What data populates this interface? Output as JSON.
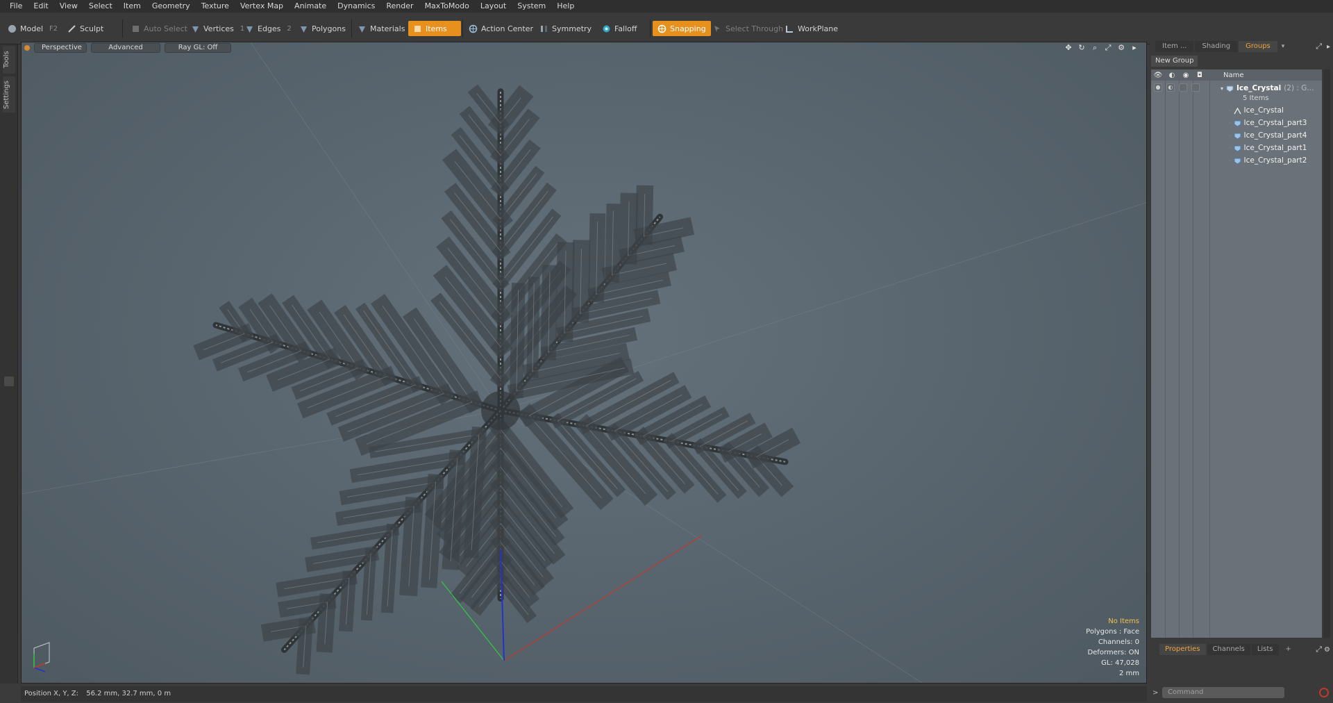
{
  "menu": [
    "File",
    "Edit",
    "View",
    "Select",
    "Item",
    "Geometry",
    "Texture",
    "Vertex Map",
    "Animate",
    "Dynamics",
    "Render",
    "MaxToModo",
    "Layout",
    "System",
    "Help"
  ],
  "toolbar": {
    "model": "Model",
    "model_key": "F2",
    "sculpt": "Sculpt",
    "auto_select": "Auto Select",
    "vertices": "Vertices",
    "vertices_key": "1",
    "edges": "Edges",
    "edges_key": "2",
    "polygons": "Polygons",
    "materials": "Materials",
    "items": "Items",
    "action_center": "Action Center",
    "symmetry": "Symmetry",
    "falloff": "Falloff",
    "snapping": "Snapping",
    "select_through": "Select Through",
    "workplane": "WorkPlane"
  },
  "left_tabs": [
    "Tools",
    "Settings"
  ],
  "viewport": {
    "view": "Perspective",
    "advanced": "Advanced",
    "raygl": "Ray GL: Off",
    "info": {
      "items": "No Items",
      "polygons": "Polygons : Face",
      "channels": "Channels: 0",
      "deformers": "Deformers: ON",
      "gl": "GL: 47,028",
      "scale": "2 mm"
    }
  },
  "statusbar": {
    "label": "Position X, Y, Z:",
    "value": "56.2 mm, 32.7 mm, 0 m"
  },
  "right_panel": {
    "tabs": [
      "Item ...",
      "Shading",
      "Groups"
    ],
    "selected_tab": "Groups",
    "new_group": "New Group",
    "name_header": "Name",
    "group": {
      "name": "Ice_Crystal",
      "extra": "(2) : G...",
      "count": "5 Items"
    },
    "children": [
      {
        "name": "Ice_Crystal",
        "icon": "locator-icon"
      },
      {
        "name": "Ice_Crystal_part3",
        "icon": "mesh-icon"
      },
      {
        "name": "Ice_Crystal_part4",
        "icon": "mesh-icon"
      },
      {
        "name": "Ice_Crystal_part1",
        "icon": "mesh-icon"
      },
      {
        "name": "Ice_Crystal_part2",
        "icon": "mesh-icon"
      }
    ],
    "bottom_tabs": [
      "Properties",
      "Channels",
      "Lists",
      "+"
    ],
    "bottom_selected": "Properties",
    "command_placeholder": "Command"
  },
  "colors": {
    "accent": "#e8901e",
    "viewport_bg": "#5d6a73",
    "tree_bg": "#6b7178",
    "axis_x": "#c0392b",
    "axis_y": "#2ecc40",
    "axis_z": "#2233cc"
  }
}
